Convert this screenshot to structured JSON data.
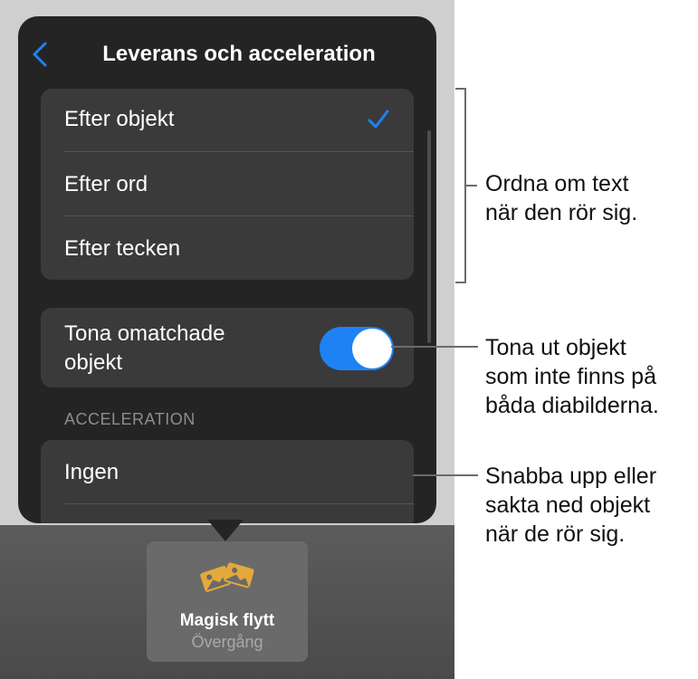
{
  "popover": {
    "title": "Leverans och acceleration",
    "delivery_options": [
      {
        "label": "Efter objekt",
        "selected": true
      },
      {
        "label": "Efter ord",
        "selected": false
      },
      {
        "label": "Efter tecken",
        "selected": false
      }
    ],
    "fade_toggle": {
      "label_line1": "Tona omatchade",
      "label_line2": "objekt",
      "on": true
    },
    "acceleration_header": "ACCELERATION",
    "acceleration_options": [
      {
        "label": "Ingen"
      }
    ]
  },
  "transition_thumb": {
    "title": "Magisk flytt",
    "subtitle": "Övergång"
  },
  "callouts": {
    "reorder": [
      "Ordna om text",
      "när den rör sig."
    ],
    "fade": [
      "Tona ut objekt",
      "som inte finns på",
      "båda diabilderna."
    ],
    "speed": [
      "Snabba upp eller",
      "sakta ned objekt",
      "när de rör sig."
    ]
  },
  "colors": {
    "accent": "#1E82F4",
    "popover_bg": "#242424",
    "row_bg": "#3A3A3A",
    "icon_gold": "#E2A93B"
  },
  "icons": {
    "back": "chevron-left-icon",
    "check": "checkmark-icon",
    "transition": "magic-move-icon"
  }
}
